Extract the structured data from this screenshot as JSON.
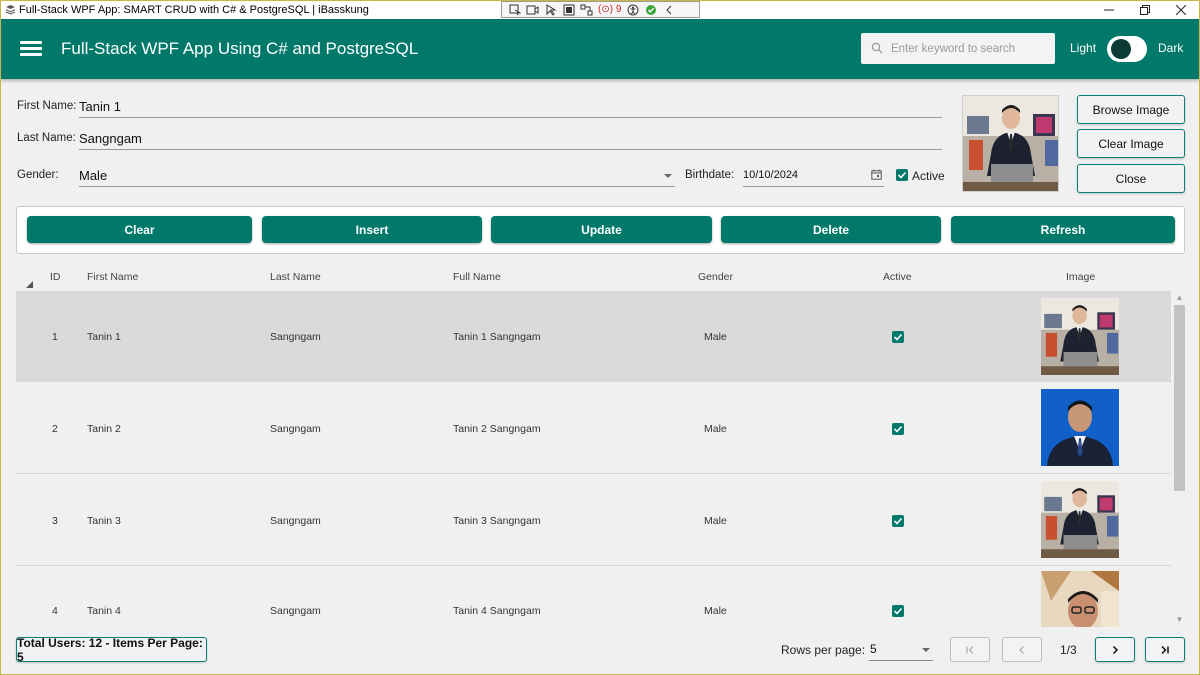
{
  "window": {
    "title": "Full-Stack WPF App: SMART CRUD with C# & PostgreSQL | iBasskung",
    "devbar_counter": "9"
  },
  "header": {
    "title": "Full-Stack WPF App Using C# and PostgreSQL",
    "search_placeholder": "Enter keyword to search",
    "search_value": "",
    "theme_light_label": "Light",
    "theme_dark_label": "Dark",
    "theme_is_dark": false,
    "color": "#00796b"
  },
  "form": {
    "first_name_label": "First Name:",
    "first_name_value": "Tanin 1",
    "last_name_label": "Last Name:",
    "last_name_value": "Sangngam",
    "gender_label": "Gender:",
    "gender_value": "Male",
    "birthdate_label": "Birthdate:",
    "birthdate_value": "10/10/2024",
    "active_label": "Active",
    "active_checked": true,
    "browse_image_label": "Browse Image",
    "clear_image_label": "Clear Image",
    "close_label": "Close"
  },
  "actions": {
    "clear": "Clear",
    "insert": "Insert",
    "update": "Update",
    "delete": "Delete",
    "refresh": "Refresh"
  },
  "grid": {
    "columns": [
      "ID",
      "First Name",
      "Last Name",
      "Full Name",
      "Gender",
      "Active",
      "Image"
    ],
    "rows": [
      {
        "id": "1",
        "first_name": "Tanin 1",
        "last_name": "Sangngam",
        "full_name": "Tanin 1 Sangngam",
        "gender": "Male",
        "active": true,
        "image": "office-photo",
        "selected": true
      },
      {
        "id": "2",
        "first_name": "Tanin 2",
        "last_name": "Sangngam",
        "full_name": "Tanin 2 Sangngam",
        "gender": "Male",
        "active": true,
        "image": "blue-portrait",
        "selected": false
      },
      {
        "id": "3",
        "first_name": "Tanin 3",
        "last_name": "Sangngam",
        "full_name": "Tanin 3 Sangngam",
        "gender": "Male",
        "active": true,
        "image": "office-photo",
        "selected": false
      },
      {
        "id": "4",
        "first_name": "Tanin 4",
        "last_name": "Sangngam",
        "full_name": "Tanin 4 Sangngam",
        "gender": "Male",
        "active": true,
        "image": "selfie-photo",
        "selected": false
      }
    ]
  },
  "footer": {
    "total_text": "Total Users: 12 - Items Per Page: 5",
    "rows_per_page_label": "Rows per page:",
    "rows_per_page_value": "5",
    "page_info": "1/3"
  }
}
